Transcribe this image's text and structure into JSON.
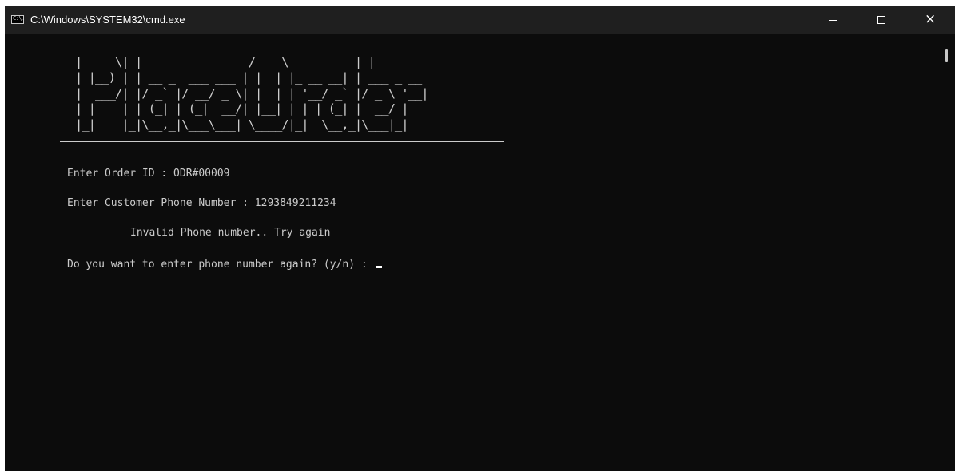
{
  "window": {
    "title": "C:\\Windows\\SYSTEM32\\cmd.exe",
    "icon": "cmd-icon",
    "icon_text": "C:\\.",
    "controls": {
      "minimize": "minimize-icon",
      "maximize": "maximize-icon",
      "close": "×"
    }
  },
  "console": {
    "banner": " _____  _                  ____            _\n|  __ \\| |                / __ \\          | |\n| |__) | | __ _  ___ ___ | |  | |_ __ __| | ___ _ __\n|  ___/| |/ _` |/ __/ _ \\| |  | | '__/ _` |/ _ \\ '__|\n| |    | | (_| | (_|  __/| |__| | | | (_| |  __/ |\n|_|    |_|\\__,_|\\___\\___| \\____/|_|  \\__,_|\\___|_|",
    "lines": [
      "Enter Order ID : ODR#00009",
      "Enter Customer Phone Number : 1293849211234",
      "Invalid Phone number.. Try again",
      "Do you want to enter phone number again? (y/n) : "
    ]
  },
  "colors": {
    "console_bg": "#0c0c0c",
    "titlebar_bg": "#1f1f1f",
    "text": "#cccccc"
  }
}
